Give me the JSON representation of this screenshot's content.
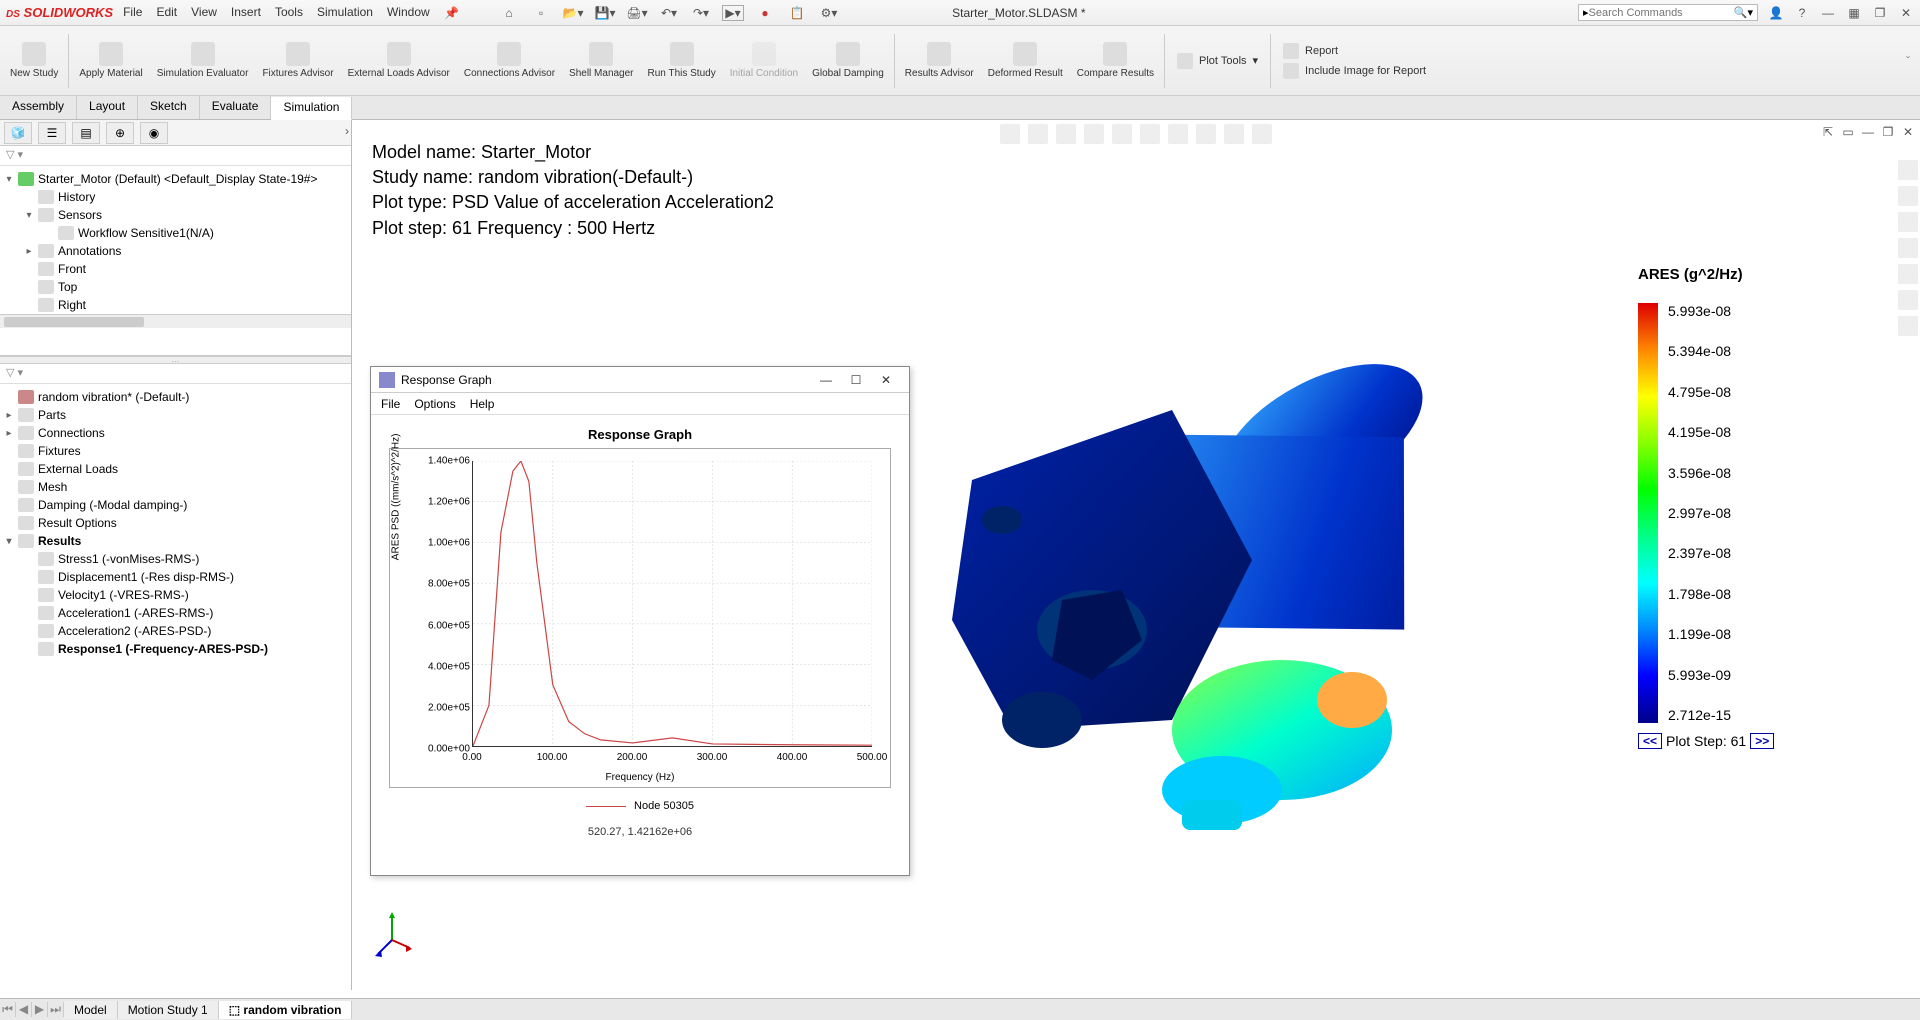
{
  "app": {
    "name": "SOLIDWORKS",
    "doc_title": "Starter_Motor.SLDASM *"
  },
  "menu": [
    "File",
    "Edit",
    "View",
    "Insert",
    "Tools",
    "Simulation",
    "Window"
  ],
  "search_placeholder": "Search Commands",
  "ribbon": [
    {
      "label": "New\nStudy"
    },
    {
      "label": "Apply\nMaterial"
    },
    {
      "label": "Simulation\nEvaluator"
    },
    {
      "label": "Fixtures\nAdvisor"
    },
    {
      "label": "External Loads\nAdvisor"
    },
    {
      "label": "Connections\nAdvisor"
    },
    {
      "label": "Shell\nManager"
    },
    {
      "label": "Run This\nStudy"
    },
    {
      "label": "Initial\nCondition",
      "disabled": true
    },
    {
      "label": "Global\nDamping"
    },
    {
      "label": "Results\nAdvisor"
    },
    {
      "label": "Deformed\nResult"
    },
    {
      "label": "Compare\nResults"
    }
  ],
  "ribbon_side": [
    {
      "label": "Plot Tools"
    },
    {
      "label": "Report"
    },
    {
      "label": "Include Image for Report"
    }
  ],
  "tabs": [
    "Assembly",
    "Layout",
    "Sketch",
    "Evaluate",
    "Simulation"
  ],
  "active_tab": "Simulation",
  "feature_tree_root": "Starter_Motor (Default) <Default_Display State-19#>",
  "feature_tree": [
    {
      "label": "History",
      "ind": 1
    },
    {
      "label": "Sensors",
      "ind": 1,
      "exp": "▾"
    },
    {
      "label": "Workflow Sensitive1(N/A)",
      "ind": 2
    },
    {
      "label": "Annotations",
      "ind": 1,
      "exp": "▸"
    },
    {
      "label": "Front",
      "ind": 1
    },
    {
      "label": "Top",
      "ind": 1
    },
    {
      "label": "Right",
      "ind": 1
    }
  ],
  "sim_tree_root": "random vibration* (-Default-)",
  "sim_tree": [
    {
      "label": "Parts",
      "exp": "▸"
    },
    {
      "label": "Connections",
      "exp": "▸"
    },
    {
      "label": "Fixtures"
    },
    {
      "label": "External Loads"
    },
    {
      "label": "Mesh"
    },
    {
      "label": "Damping (-Modal damping-)"
    },
    {
      "label": "Result Options"
    },
    {
      "label": "Results",
      "exp": "▾",
      "bold": true
    },
    {
      "label": "Stress1 (-vonMises-RMS-)",
      "ind": 1
    },
    {
      "label": "Displacement1 (-Res disp-RMS-)",
      "ind": 1
    },
    {
      "label": "Velocity1 (-VRES-RMS-)",
      "ind": 1
    },
    {
      "label": "Acceleration1 (-ARES-RMS-)",
      "ind": 1
    },
    {
      "label": "Acceleration2 (-ARES-PSD-)",
      "ind": 1
    },
    {
      "label": "Response1 (-Frequency-ARES-PSD-)",
      "ind": 1,
      "bold": true
    }
  ],
  "plot_info": [
    "Model name: Starter_Motor",
    "Study name: random vibration(-Default-)",
    "Plot type: PSD Value of acceleration Acceleration2",
    "Plot step: 61 Frequency : 500 Hertz"
  ],
  "legend": {
    "title": "ARES (g^2/Hz)",
    "values": [
      "5.993e-08",
      "5.394e-08",
      "4.795e-08",
      "4.195e-08",
      "3.596e-08",
      "2.997e-08",
      "2.397e-08",
      "1.798e-08",
      "1.199e-08",
      "5.993e-09",
      "2.712e-15"
    ],
    "step_label": "Plot Step: 61"
  },
  "rg": {
    "title": "Response Graph",
    "menu": [
      "File",
      "Options",
      "Help"
    ],
    "chart_title": "Response Graph",
    "ylabel": "ARES PSD ((mm/s^2)^2/Hz)",
    "xlabel": "Frequency (Hz)",
    "legend": "Node 50305",
    "cursor": "520.27, 1.42162e+06"
  },
  "chart_data": {
    "type": "line",
    "title": "Response Graph",
    "xlabel": "Frequency (Hz)",
    "ylabel": "ARES PSD ((mm/s^2)^2/Hz)",
    "xlim": [
      0,
      500
    ],
    "ylim": [
      0,
      1400000.0
    ],
    "x_ticks": [
      "0.00",
      "100.00",
      "200.00",
      "300.00",
      "400.00",
      "500.00"
    ],
    "y_ticks": [
      "0.00e+00",
      "2.00e+05",
      "4.00e+05",
      "6.00e+05",
      "8.00e+05",
      "1.00e+06",
      "1.20e+06",
      "1.40e+06"
    ],
    "series": [
      {
        "name": "Node 50305",
        "x": [
          0,
          20,
          35,
          50,
          60,
          70,
          80,
          100,
          120,
          140,
          160,
          200,
          250,
          300,
          350,
          400,
          450,
          500
        ],
        "y": [
          0,
          200000.0,
          1050000.0,
          1350000.0,
          1400000.0,
          1300000.0,
          900000.0,
          300000.0,
          120000.0,
          60000.0,
          30000.0,
          15000.0,
          40000.0,
          10000.0,
          8000.0,
          6000.0,
          5000.0,
          4000.0
        ]
      }
    ]
  },
  "bottom_tabs": [
    "Model",
    "Motion Study 1",
    "random vibration"
  ],
  "bottom_active": "random vibration"
}
